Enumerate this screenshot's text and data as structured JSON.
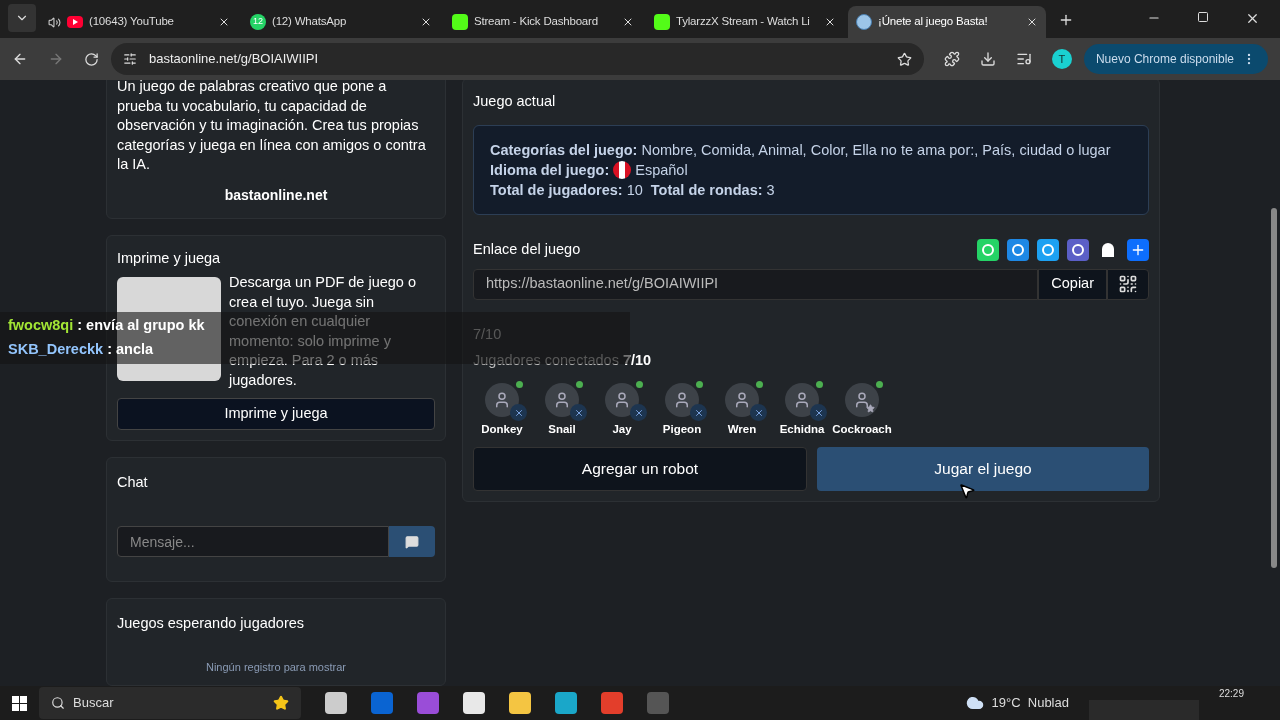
{
  "browser": {
    "tabs": [
      {
        "title": "(10643) YouTube",
        "audio": true,
        "selected": false
      },
      {
        "title": "(12) WhatsApp",
        "badge": "12",
        "selected": false
      },
      {
        "title": "Stream - Kick Dashboard",
        "selected": false
      },
      {
        "title": "TylarzzX Stream - Watch Li",
        "selected": false
      },
      {
        "title": "¡Únete al juego Basta!",
        "selected": true
      }
    ],
    "url": "bastaonline.net/g/BOIAIWIIPI",
    "profile": "T",
    "update_button": "Nuevo Chrome disponible"
  },
  "sidebar": {
    "about": {
      "text": "Un juego de palabras creativo que pone a prueba tu vocabulario, tu capacidad de observación y tu imaginación. Crea tus propias categorías y juega en línea con amigos o contra la IA.",
      "site": "bastaonline.net"
    },
    "print": {
      "title": "Imprime y juega",
      "text": "Descarga un PDF de juego o crea el tuyo. Juega sin conexión en cualquier momento: solo imprime y empieza. Para 2 o más jugadores.",
      "button": "Imprime y juega"
    },
    "chat": {
      "title": "Chat",
      "placeholder": "Mensaje..."
    },
    "waiting": {
      "title": "Juegos esperando jugadores",
      "empty": "Ningún registro para mostrar"
    }
  },
  "game": {
    "title": "Juego actual",
    "info": [
      {
        "label": "Categorías del juego:",
        "value": "Nombre, Comida, Animal, Color, Ella no te ama por:, País, ciudad o lugar"
      },
      {
        "label": "Idioma del juego:",
        "value": "Español",
        "flag": true
      },
      {
        "label": "Total de jugadores:",
        "value": "10",
        "label2": "Total de rondas:",
        "value2": "3"
      }
    ],
    "link_label": "Enlace del juego",
    "link": "https://bastaonline.net/g/BOIAIWIIPI",
    "copy": "Copiar",
    "count": "7/10",
    "connected_label": "Jugadores conectados",
    "connected": "7/10",
    "players": [
      {
        "name": "Donkey",
        "kind": "bot",
        "online": true
      },
      {
        "name": "Snail",
        "kind": "bot",
        "online": true
      },
      {
        "name": "Jay",
        "kind": "bot",
        "online": true
      },
      {
        "name": "Pigeon",
        "kind": "bot",
        "online": true
      },
      {
        "name": "Wren",
        "kind": "bot",
        "online": true
      },
      {
        "name": "Echidna",
        "kind": "bot",
        "online": true
      },
      {
        "name": "Cockroach",
        "kind": "host",
        "online": true
      }
    ],
    "add_robot": "Agregar un robot",
    "play": "Jugar el juego"
  },
  "stream_chat": [
    {
      "user": "fwocw8qi",
      "color": "#a3e635",
      "message": ": envía al grupo kk"
    },
    {
      "user": "SKB_Dereckk",
      "color": "#93c5fd",
      "message": ": ancla"
    }
  ],
  "taskbar": {
    "search": "Buscar",
    "weather": "19°C  Nublad",
    "clock": "22:29"
  }
}
